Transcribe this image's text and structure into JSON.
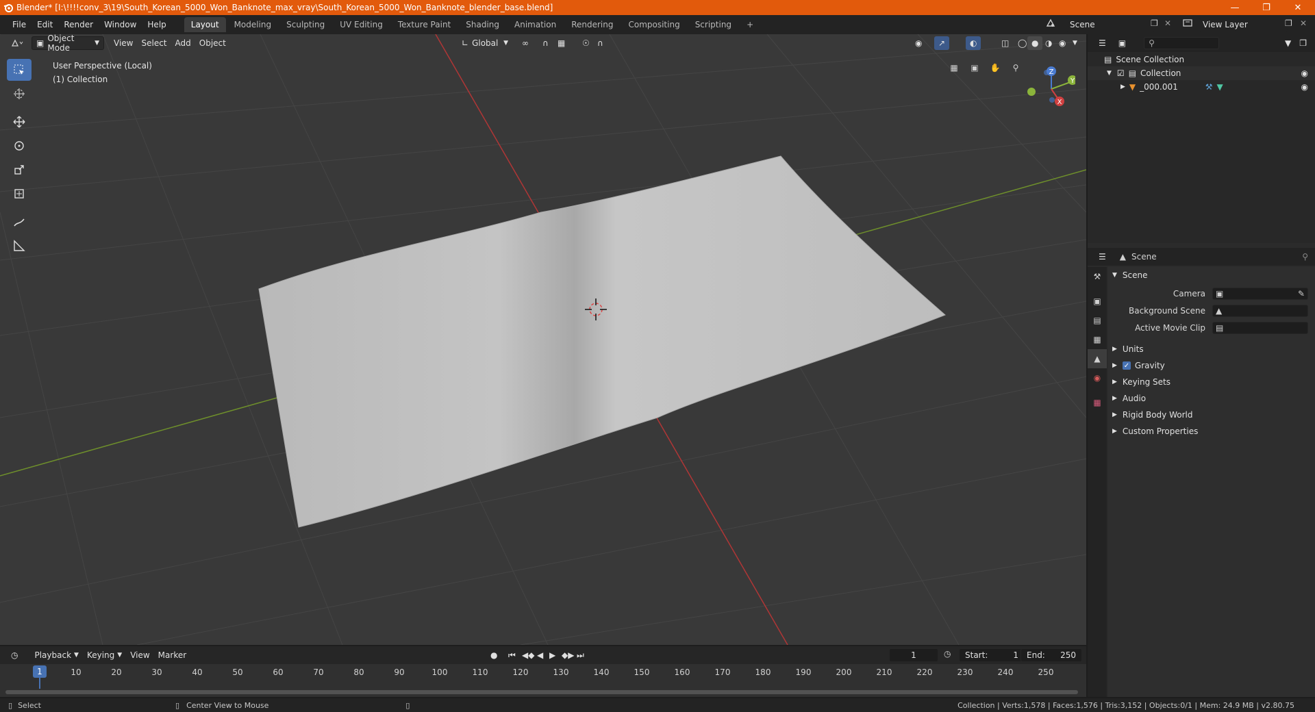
{
  "window": {
    "title": "Blender* [I:\\!!!!conv_3\\19\\South_Korean_5000_Won_Banknote_max_vray\\South_Korean_5000_Won_Banknote_blender_base.blend]"
  },
  "menus": [
    "File",
    "Edit",
    "Render",
    "Window",
    "Help"
  ],
  "workspaces": [
    {
      "label": "Layout",
      "active": true
    },
    {
      "label": "Modeling"
    },
    {
      "label": "Sculpting"
    },
    {
      "label": "UV Editing"
    },
    {
      "label": "Texture Paint"
    },
    {
      "label": "Shading"
    },
    {
      "label": "Animation"
    },
    {
      "label": "Rendering"
    },
    {
      "label": "Compositing"
    },
    {
      "label": "Scripting"
    }
  ],
  "scene_selector": {
    "value": "Scene"
  },
  "view_layer_selector": {
    "value": "View Layer"
  },
  "viewport_header": {
    "mode": "Object Mode",
    "menus": [
      "View",
      "Select",
      "Add",
      "Object"
    ],
    "transform_orientation": "Global"
  },
  "viewport_info": {
    "line1": "User Perspective (Local)",
    "line2": "(1) Collection"
  },
  "gizmo": {
    "x": "X",
    "y": "Y",
    "z": "Z"
  },
  "outliner": {
    "rows": [
      {
        "label": "Scene Collection"
      },
      {
        "label": "Collection"
      },
      {
        "label": "_000.001"
      }
    ]
  },
  "properties": {
    "header": "Scene",
    "panel_scene": "Scene",
    "camera_label": "Camera",
    "background_scene_label": "Background Scene",
    "active_movie_clip_label": "Active Movie Clip",
    "subpanels": [
      "Units",
      "Gravity",
      "Keying Sets",
      "Audio",
      "Rigid Body World",
      "Custom Properties"
    ]
  },
  "timeline": {
    "menus": [
      "Playback",
      "Keying",
      "View",
      "Marker"
    ],
    "current_frame": "1",
    "start_label": "Start:",
    "start_value": "1",
    "end_label": "End:",
    "end_value": "250",
    "ticks": [
      "10",
      "20",
      "30",
      "40",
      "50",
      "60",
      "70",
      "80",
      "90",
      "100",
      "110",
      "120",
      "130",
      "140",
      "150",
      "160",
      "170",
      "180",
      "190",
      "200",
      "210",
      "220",
      "230",
      "240",
      "250"
    ],
    "playhead": "1"
  },
  "statusbar": {
    "left_action": "Select",
    "middle_action": "Center View to Mouse",
    "stats": "Collection | Verts:1,578 | Faces:1,576 | Tris:3,152 | Objects:0/1 | Mem: 24.9 MB | v2.80.75"
  },
  "colors": {
    "title_bar": "#e25a0c",
    "accent": "#4772b3",
    "x_axis": "#c63a3a",
    "y_axis": "#7aa52c"
  }
}
